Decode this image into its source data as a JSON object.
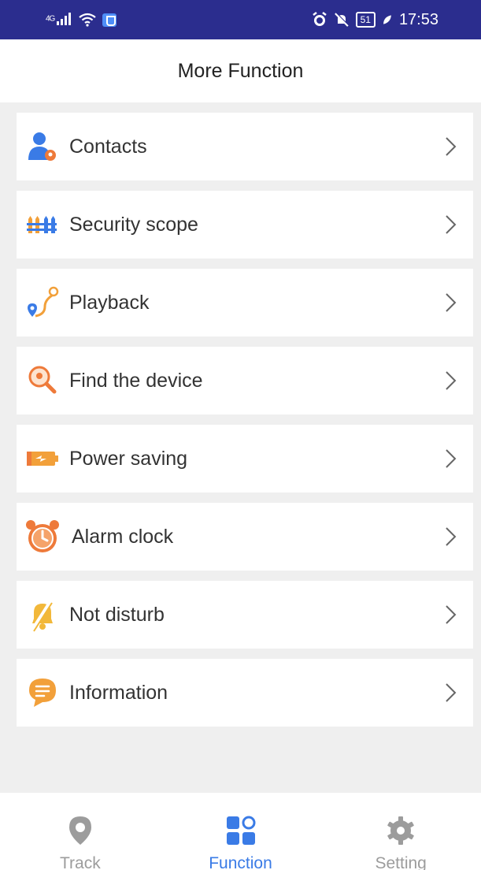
{
  "status_bar": {
    "signal": "4G",
    "battery": "51",
    "time": "17:53"
  },
  "header": {
    "title": "More Function"
  },
  "menu": {
    "items": [
      {
        "label": "Contacts",
        "icon": "contacts-icon"
      },
      {
        "label": "Security scope",
        "icon": "fence-icon"
      },
      {
        "label": "Playback",
        "icon": "route-icon"
      },
      {
        "label": "Find the device",
        "icon": "search-icon"
      },
      {
        "label": "Power saving",
        "icon": "battery-icon"
      },
      {
        "label": "Alarm clock",
        "icon": "alarm-clock-icon"
      },
      {
        "label": "Not disturb",
        "icon": "bell-off-icon"
      },
      {
        "label": "Information",
        "icon": "message-icon"
      }
    ]
  },
  "nav": {
    "items": [
      {
        "label": "Track",
        "icon": "location-pin-icon",
        "active": false
      },
      {
        "label": "Function",
        "icon": "grid-icon",
        "active": true
      },
      {
        "label": "Setting",
        "icon": "gear-icon",
        "active": false
      }
    ]
  },
  "colors": {
    "status_bar_bg": "#2b2d8e",
    "accent": "#3a7be6",
    "inactive": "#9c9c9c",
    "background": "#efefef"
  }
}
